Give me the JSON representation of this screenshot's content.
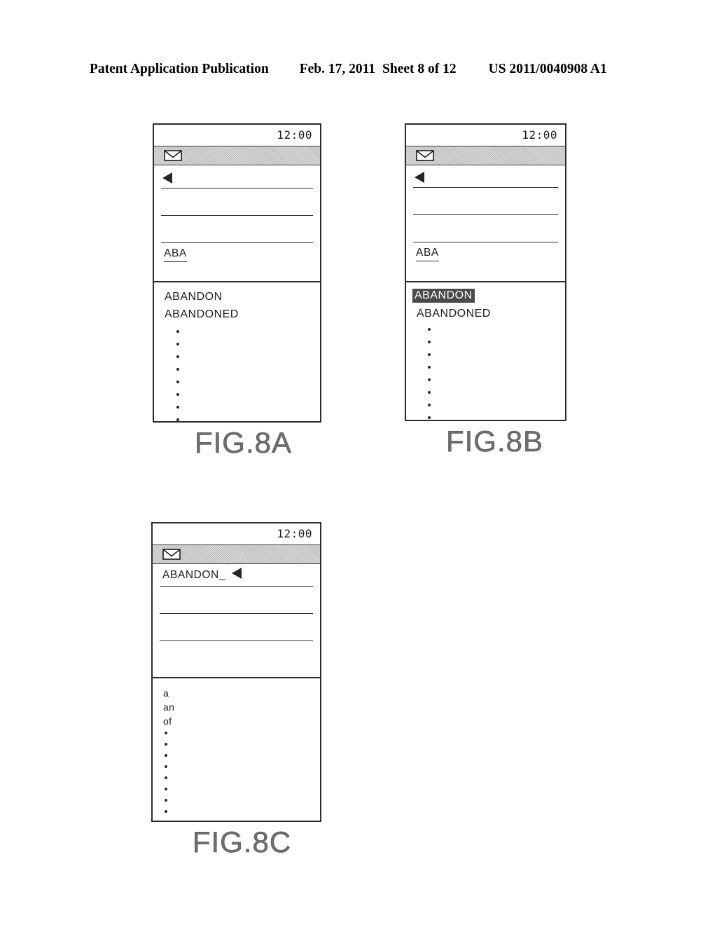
{
  "header": {
    "publication": "Patent Application Publication",
    "date": "Feb. 17, 2011",
    "sheet": "Sheet 8 of 12",
    "document_id": "US 2011/0040908 A1"
  },
  "figures": [
    {
      "caption": "FIG.8A",
      "status_bar": {
        "clock": "12:00",
        "mail_icon": "envelope-icon"
      },
      "entry": {
        "caret_icon": "left-triangle-caret",
        "typed_text": "ABA",
        "line_count": 4
      },
      "candidates": {
        "items": [
          "ABANDON",
          "ABANDONED"
        ],
        "selected_index": -1,
        "ellipsis_dots": 8
      }
    },
    {
      "caption": "FIG.8B",
      "status_bar": {
        "clock": "12:00",
        "mail_icon": "envelope-icon"
      },
      "entry": {
        "caret_icon": "left-triangle-caret",
        "typed_text": "ABA",
        "line_count": 4
      },
      "candidates": {
        "items": [
          "ABANDON",
          "ABANDONED"
        ],
        "selected_index": 0,
        "ellipsis_dots": 8
      }
    },
    {
      "caption": "FIG.8C",
      "status_bar": {
        "clock": "12:00",
        "mail_icon": "envelope-icon"
      },
      "entry": {
        "caret_icon": "left-triangle-caret",
        "typed_text": "ABANDON_",
        "line_count": 3
      },
      "candidates": {
        "items": [
          "a",
          "an",
          "of"
        ],
        "selected_index": -1,
        "ellipsis_dots": 8
      }
    }
  ],
  "colors": {
    "ink": "#1c1c1c",
    "frame": "#2b2b2b",
    "status_bar_fill": "#b9b9b9",
    "selection_fill": "#4a4a4a",
    "caption_gray": "#6e6e6e"
  }
}
